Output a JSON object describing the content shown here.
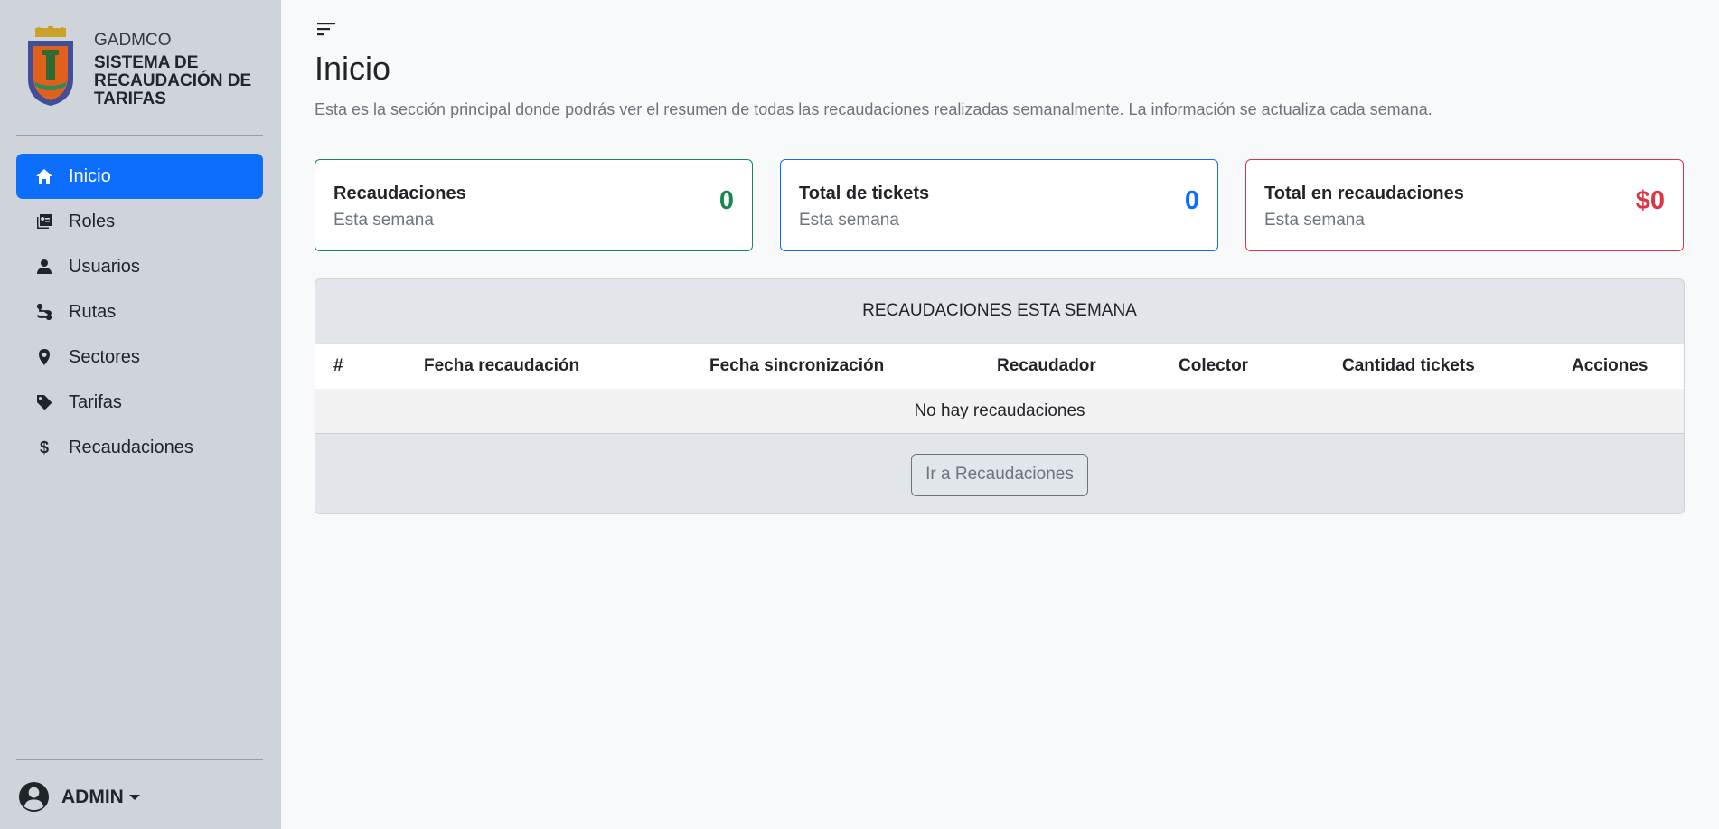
{
  "colors": {
    "sidebar_bg": "#ced4da",
    "primary": "#0d6efd",
    "success": "#198754",
    "danger": "#dc3545"
  },
  "brand": {
    "org": "GADMCO",
    "system": "SISTEMA DE RECAUDACIÓN DE TARIFAS"
  },
  "sidebar": {
    "items": [
      {
        "label": "Inicio",
        "icon": "home-icon",
        "active": true
      },
      {
        "label": "Roles",
        "icon": "roles-icon"
      },
      {
        "label": "Usuarios",
        "icon": "user-icon"
      },
      {
        "label": "Rutas",
        "icon": "route-icon"
      },
      {
        "label": "Sectores",
        "icon": "location-pin-icon"
      },
      {
        "label": "Tarifas",
        "icon": "tag-icon"
      },
      {
        "label": "Recaudaciones",
        "icon": "dollar-icon"
      }
    ]
  },
  "user": {
    "name": "ADMIN"
  },
  "page": {
    "title": "Inicio",
    "description": "Esta es la sección principal donde podrás ver el resumen de todas las recaudaciones realizadas semanalmente. La información se actualiza cada semana."
  },
  "cards": [
    {
      "title": "Recaudaciones",
      "subtitle": "Esta semana",
      "value": "0",
      "color": "#198754"
    },
    {
      "title": "Total de tickets",
      "subtitle": "Esta semana",
      "value": "0",
      "color": "#0d6efd"
    },
    {
      "title": "Total en recaudaciones",
      "subtitle": "Esta semana",
      "value": "$0",
      "color": "#dc3545"
    }
  ],
  "table": {
    "title": "RECAUDACIONES ESTA SEMANA",
    "columns": [
      "#",
      "Fecha recaudación",
      "Fecha sincronización",
      "Recaudador",
      "Colector",
      "Cantidad tickets",
      "Acciones"
    ],
    "empty_message": "No hay recaudaciones",
    "footer_button": "Ir a Recaudaciones"
  }
}
